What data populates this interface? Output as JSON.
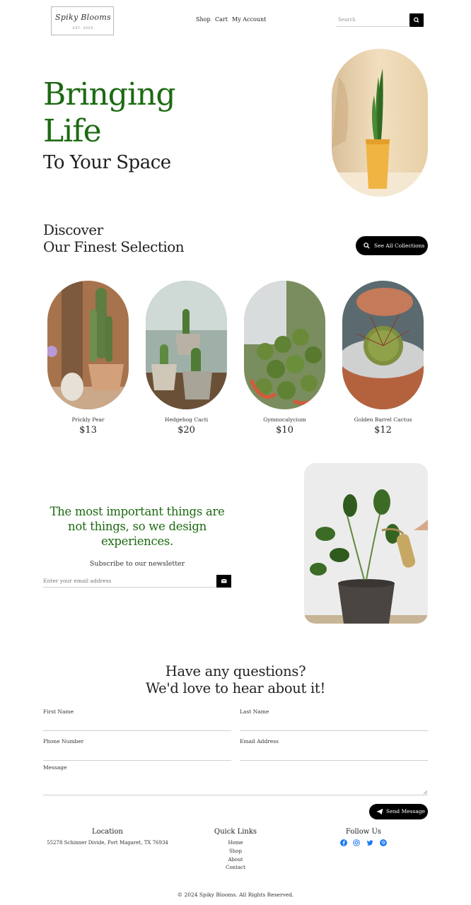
{
  "header": {
    "logo_text": "Spiky Blooms",
    "logo_sub": "EST. 2020",
    "nav": [
      "Shop",
      "Cart",
      "My Account"
    ],
    "search_placeholder": "Search"
  },
  "hero": {
    "title_line1": "Bringing",
    "title_line2": "Life",
    "subtitle": "To Your Space"
  },
  "discover": {
    "line1": "Discover",
    "line2": "Our Finest Selection",
    "button": "See All Collections"
  },
  "products": [
    {
      "name": "Prickly Pear",
      "price": "$13"
    },
    {
      "name": "Hedgehog Cacti",
      "price": "$20"
    },
    {
      "name": "Gymnocalycium",
      "price": "$10"
    },
    {
      "name": "Golden Barrel Cactus",
      "price": "$12"
    }
  ],
  "newsletter": {
    "quote": "The most important things are not things, so we design experiences.",
    "label": "Subscribe to our newsletter",
    "placeholder": "Enter your email address"
  },
  "contact": {
    "title_line1": "Have any questions?",
    "title_line2": "We'd love to hear about it!",
    "first_name": "First Name",
    "last_name": "Last Name",
    "phone": "Phone Number",
    "email": "Email Address",
    "message": "Message",
    "send": "Send Message"
  },
  "footer": {
    "location_title": "Location",
    "address": "55278 Schinner Divide, Port Magaret, TX 76934",
    "links_title": "Quick Links",
    "links": [
      "Home",
      "Shop",
      "About",
      "Contact"
    ],
    "follow_title": "Follow Us",
    "socials": [
      "facebook-icon",
      "instagram-icon",
      "twitter-icon",
      "pinterest-icon"
    ],
    "social_color": "#1877f2",
    "copyright": "© 2024 Spiky Blooms. All Rights Reserved."
  },
  "colors": {
    "accent_green": "#1d6a12",
    "button_black": "#000000"
  }
}
